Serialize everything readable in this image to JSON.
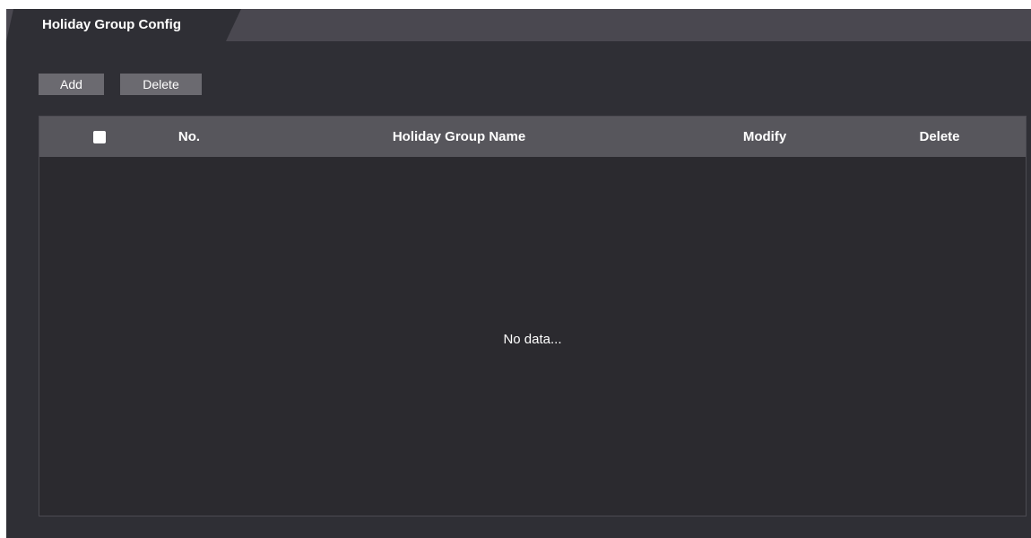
{
  "tab": {
    "label": "Holiday Group Config"
  },
  "toolbar": {
    "add_label": "Add",
    "delete_label": "Delete"
  },
  "table": {
    "columns": [
      {
        "key": "select",
        "label": "",
        "icon": "checkbox-icon"
      },
      {
        "key": "no",
        "label": "No."
      },
      {
        "key": "name",
        "label": "Holiday Group Name"
      },
      {
        "key": "modify",
        "label": "Modify"
      },
      {
        "key": "delete",
        "label": "Delete"
      }
    ],
    "rows": [],
    "empty_text": "No data..."
  },
  "colors": {
    "panel_bg": "#2f2f35",
    "tab_bar": "#4a4850",
    "tab_active": "#2f2f35",
    "button_bg": "#6b6a70",
    "table_header_bg": "#57565c",
    "table_body_bg": "#2b2a2f",
    "text": "#ffffff"
  }
}
